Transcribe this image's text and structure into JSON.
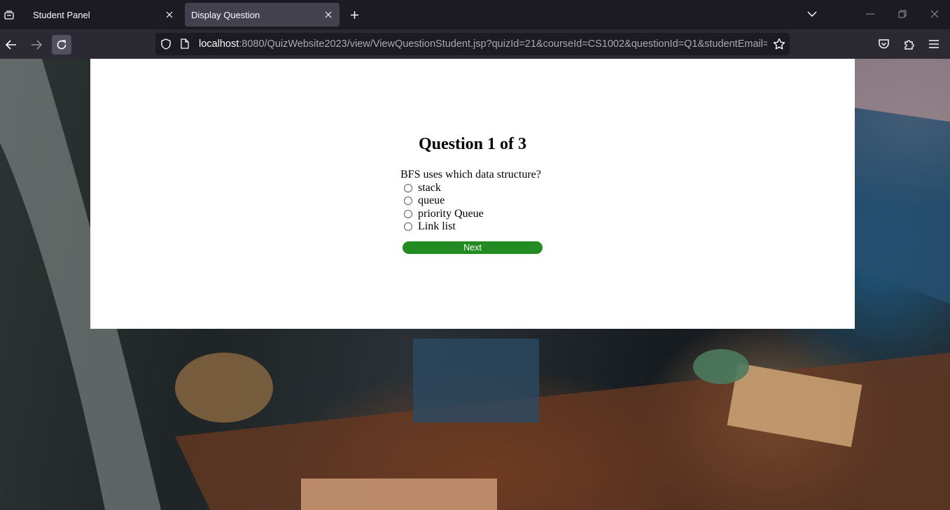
{
  "browser": {
    "tabs": [
      {
        "label": "Student Panel",
        "active": false
      },
      {
        "label": "Display Question",
        "active": true
      }
    ],
    "url": {
      "host": "localhost",
      "rest": ":8080/QuizWebsite2023/view/ViewQuestionStudent.jsp?quizId=21&courseId=CS1002&questionId=Q1&studentEmail=Mal"
    },
    "icons": {
      "tab_list": "firefox-view-icon",
      "close": "close-icon",
      "new_tab": "plus-icon",
      "list_all_tabs": "chevron-down-icon",
      "back": "back-arrow-icon",
      "forward": "forward-arrow-icon",
      "reload": "reload-icon",
      "bookmark": "star-icon",
      "pocket": "pocket-icon",
      "extensions": "puzzle-icon",
      "menu": "hamburger-icon"
    }
  },
  "quiz": {
    "heading": "Question 1 of 3",
    "question": "BFS uses which data structure?",
    "options": [
      "stack",
      "queue",
      "priority Queue",
      "Link list"
    ],
    "next_label": "Next"
  },
  "colors": {
    "panel": "#ffffff",
    "next_button": "#228b22",
    "tabbar": "#1c1b22",
    "navbar": "#2b2a33",
    "active_tab": "#42414d"
  }
}
